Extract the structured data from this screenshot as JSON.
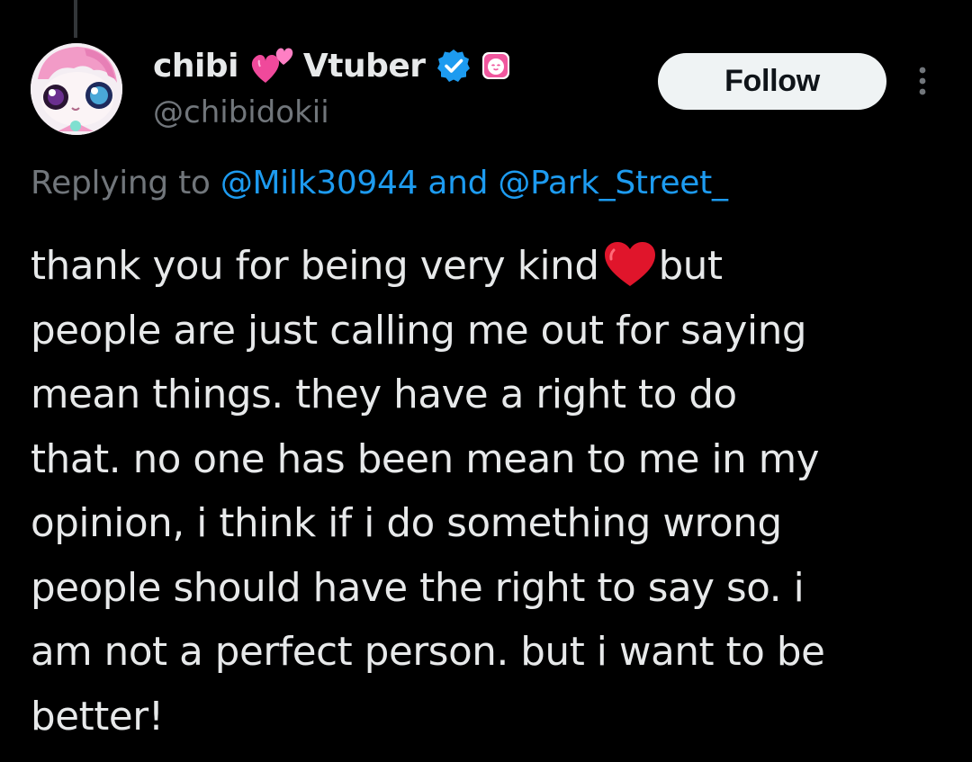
{
  "author": {
    "name_part1": "chibi",
    "name_emoji": "two-hearts-icon",
    "name_part2": "Vtuber",
    "handle": "@chibidokii",
    "verified": true,
    "badge_color": "#1d9bf0"
  },
  "follow_button": {
    "label": "Follow"
  },
  "reply_context": {
    "prefix": "Replying to ",
    "mention1": "@Milk30944",
    "conjunction": " and ",
    "mention2": "@Park_Street_"
  },
  "tweet": {
    "lines": [
      "thank you for being very kind",
      "but",
      "people are just calling me out for saying",
      "mean things. they have a right to do",
      "that. no one has been mean to me in my",
      "opinion, i think if i do something wrong",
      "people should have the right to say so. i",
      "am not a perfect person. but i want to be",
      "better!"
    ],
    "inline_emoji": "red-heart-icon"
  },
  "colors": {
    "background": "#000000",
    "text": "#e7e9ea",
    "muted": "#71767b",
    "accent": "#1d9bf0"
  }
}
